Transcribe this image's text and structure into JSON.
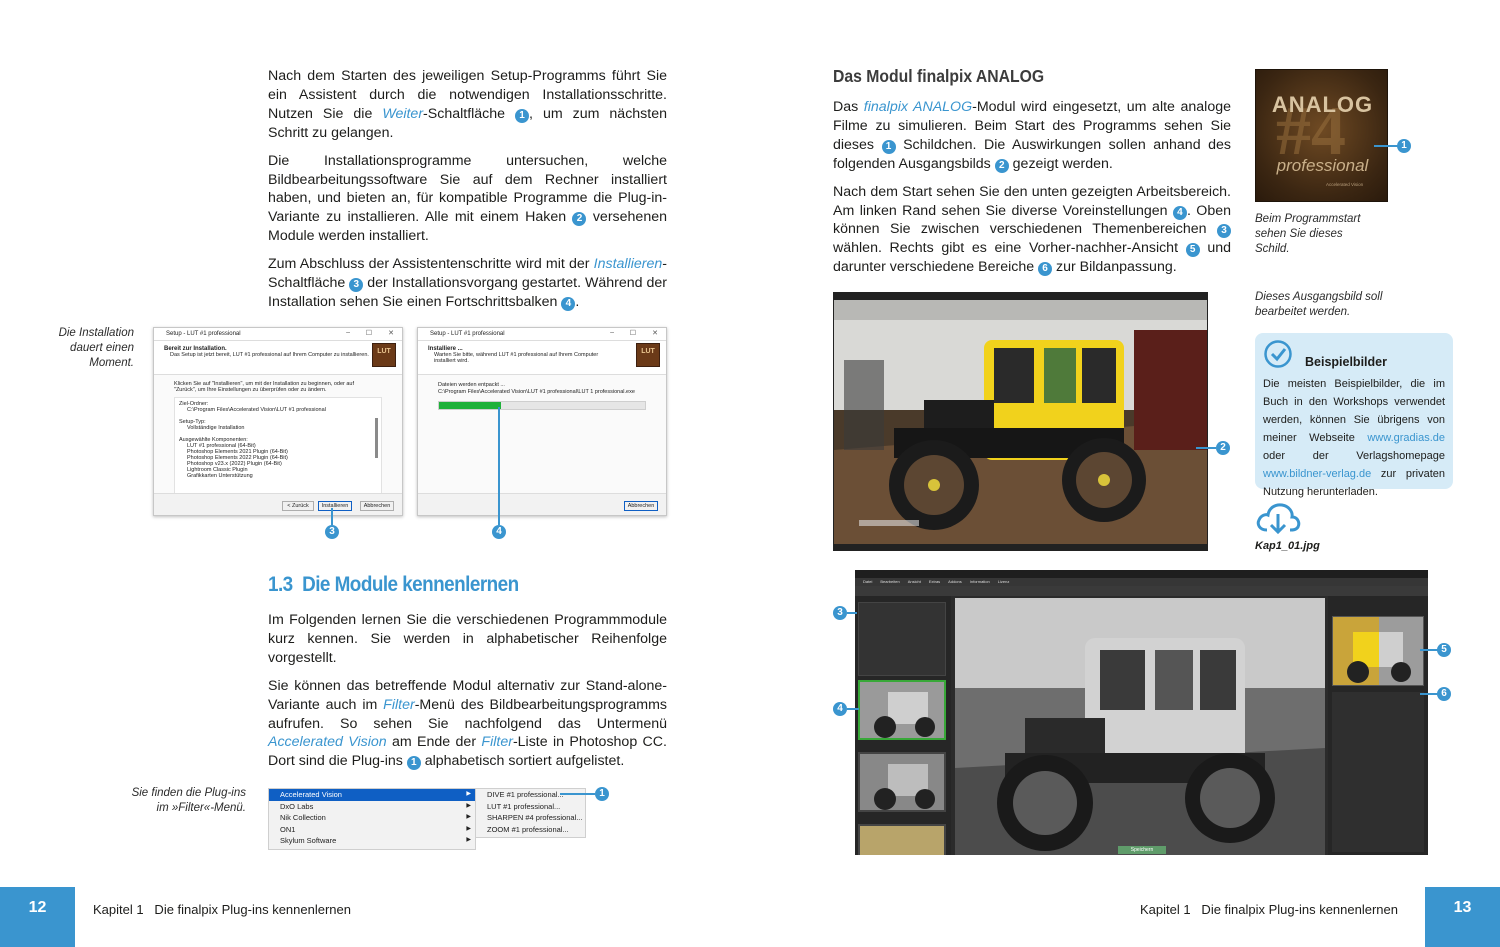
{
  "left_page": {
    "para1_a": "Nach dem Starten des jeweiligen Setup-Programms führt Sie ein Assistent durch die notwendigen Installationsschritte. Nutzen Sie die ",
    "para1_link": "Weiter",
    "para1_b": "-Schaltfläche ",
    "para1_num": "1",
    "para1_c": ", um zum nächsten Schritt zu gelangen.",
    "para2_a": "Die Installationsprogramme untersuchen, welche Bildbearbeitungssoftware Sie auf dem Rechner installiert haben, und bieten an, für kompatible Programme die Plug-in-Variante zu installieren. Alle mit einem Haken ",
    "para2_num": "2",
    "para2_b": " versehenen Module werden installiert.",
    "para3_a": "Zum Abschluss der Assistentenschritte wird mit der ",
    "para3_link": "Installieren",
    "para3_b": "-Schaltfläche ",
    "para3_num": "3",
    "para3_c": " der Installationsvorgang gestartet. Während der Installation sehen Sie einen Fortschrittsbalken ",
    "para3_num2": "4",
    "para3_d": ".",
    "caption_install": "Die Installation dauert einen Moment.",
    "dialog1": {
      "title": "Setup - LUT #1 professional",
      "head_title": "Bereit zur Installation.",
      "head_sub": "Das Setup ist jetzt bereit, LUT #1 professional auf Ihrem Computer zu installieren.",
      "logo": "LUT",
      "intro": "Klicken Sie auf \"Installieren\", um mit der Installation zu beginnen, oder auf \"Zurück\", um Ihre Einstellungen zu überprüfen oder zu ändern.",
      "lines": [
        "Ziel-Ordner:",
        "C:\\Program Files\\Accelerated Vision\\LUT #1 professional",
        "",
        "Setup-Typ:",
        "Vollständige Installation",
        "",
        "Ausgewählte Komponenten:",
        "LUT #1 professional (64-Bit)",
        "Photoshop Elements 2021 Plugin (64-Bit)",
        "Photoshop Elements 2022 Plugin (64-Bit)",
        "Photoshop v23.x (2022) Plugin (64-Bit)",
        "Lightroom Classic Plugin",
        "Grafikkarten Unterstützung"
      ],
      "btn_back": "< Zurück",
      "btn_install": "Installieren",
      "btn_cancel": "Abbrechen"
    },
    "dialog2": {
      "title": "Setup - LUT #1 professional",
      "head_title": "Installiere ...",
      "head_sub": "Warten Sie bitte, während LUT #1 professional auf Ihrem Computer installiert wird.",
      "logo": "LUT",
      "status": "Dateien werden entpackt ...",
      "path": "C:\\Program Files\\Accelerated Vision\\LUT #1 professional\\LUT 1 professional.exe",
      "progress": 0.3,
      "btn_cancel": "Abbrechen"
    },
    "callout3": "3",
    "callout4": "4",
    "section_num": "1.3",
    "section_title": "Die Module kennenlernen",
    "para4": "Im Folgenden lernen Sie die verschiedenen Programmmodule kurz kennen. Sie werden in alphabetischer Reihenfolge vorgestellt.",
    "para5_a": "Sie können das betreffende Modul alternativ zur Stand-alone-Variante auch im ",
    "para5_link1": "Filter",
    "para5_b": "-Menü des Bildbearbeitungsprogramms aufrufen. So sehen Sie nachfolgend das Untermenü ",
    "para5_link2": "Accelerated Vision",
    "para5_c": " am Ende der ",
    "para5_link3": "Filter",
    "para5_d": "-Liste in Photoshop CC. Dort sind die Plug-ins ",
    "para5_num": "1",
    "para5_e": " alphabetisch sortiert aufgelistet.",
    "caption_menu": "Sie finden die Plug-ins im »Filter«-Menü.",
    "menu_main": [
      "Accelerated Vision",
      "DxO Labs",
      "Nik Collection",
      "ON1",
      "Skylum Software"
    ],
    "menu_sub": [
      "DIVE #1 professional...",
      "LUT #1 professional...",
      "SHARPEN #4 professional...",
      "ZOOM #1 professional..."
    ],
    "callout_menu": "1",
    "page_number": "12",
    "footer": "Kapitel 1   Die finalpix Plug-ins kennenlernen"
  },
  "right_page": {
    "heading": "Das Modul finalpix ANALOG",
    "para1_a": "Das ",
    "para1_link": "finalpix ANALOG",
    "para1_b": "-Modul wird eingesetzt, um alte analoge Filme zu simulieren. Beim Start des Programms sehen Sie dieses ",
    "para1_num": "1",
    "para1_c": " Schildchen. Die Auswirkungen sollen anhand des folgenden Ausgangsbilds ",
    "para1_num2": "2",
    "para1_d": " gezeigt werden.",
    "para2_a": "Nach dem Start sehen Sie den unten gezeigten Arbeitsbereich. Am linken Rand sehen Sie diverse Voreinstellungen ",
    "para2_num": "4",
    "para2_b": ". Oben können Sie zwischen verschiedenen Themenbereichen ",
    "para2_num2": "3",
    "para2_c": " wählen. Rechts gibt es eine Vorher-nachher-Ansicht ",
    "para2_num3": "5",
    "para2_d": " und darunter verschiedene Bereiche ",
    "para2_num4": "6",
    "para2_e": " zur Bildanpassung.",
    "splash": {
      "line1": "ANALOG",
      "line2": "#4",
      "line3": "professional",
      "small": "Accelerated Vision"
    },
    "caption_splash": "Beim Programmstart sehen Sie dieses Schild.",
    "caption_car": "Dieses Ausgangsbild soll bearbeitet werden.",
    "infobox": {
      "title": "Beispielbilder",
      "text_a": "Die meisten Beispielbilder, die im Buch in den Workshops verwendet werden, können Sie übrigens von meiner Webseite ",
      "link1": "www.gradias.de",
      "text_b": " oder der Verlagshomepage ",
      "link2": "www.bildner-verlag.de",
      "text_c": " zur privaten Nutzung herunterladen."
    },
    "download_label": "Kap1_01.jpg",
    "callouts": {
      "c1": "1",
      "c2": "2",
      "c3": "3",
      "c4": "4",
      "c5": "5",
      "c6": "6"
    },
    "app": {
      "menu": [
        "Datei",
        "Bearbeiten",
        "Ansicht",
        "Extras",
        "Addons",
        "Information",
        "Lizenz"
      ],
      "save": "Speichern"
    },
    "page_number": "13",
    "footer": "Kapitel 1   Die finalpix Plug-ins kennenlernen"
  },
  "colors": {
    "accent": "#3a95cf",
    "infobox_bg": "#d6ebf7",
    "progress": "#1fb13a"
  }
}
